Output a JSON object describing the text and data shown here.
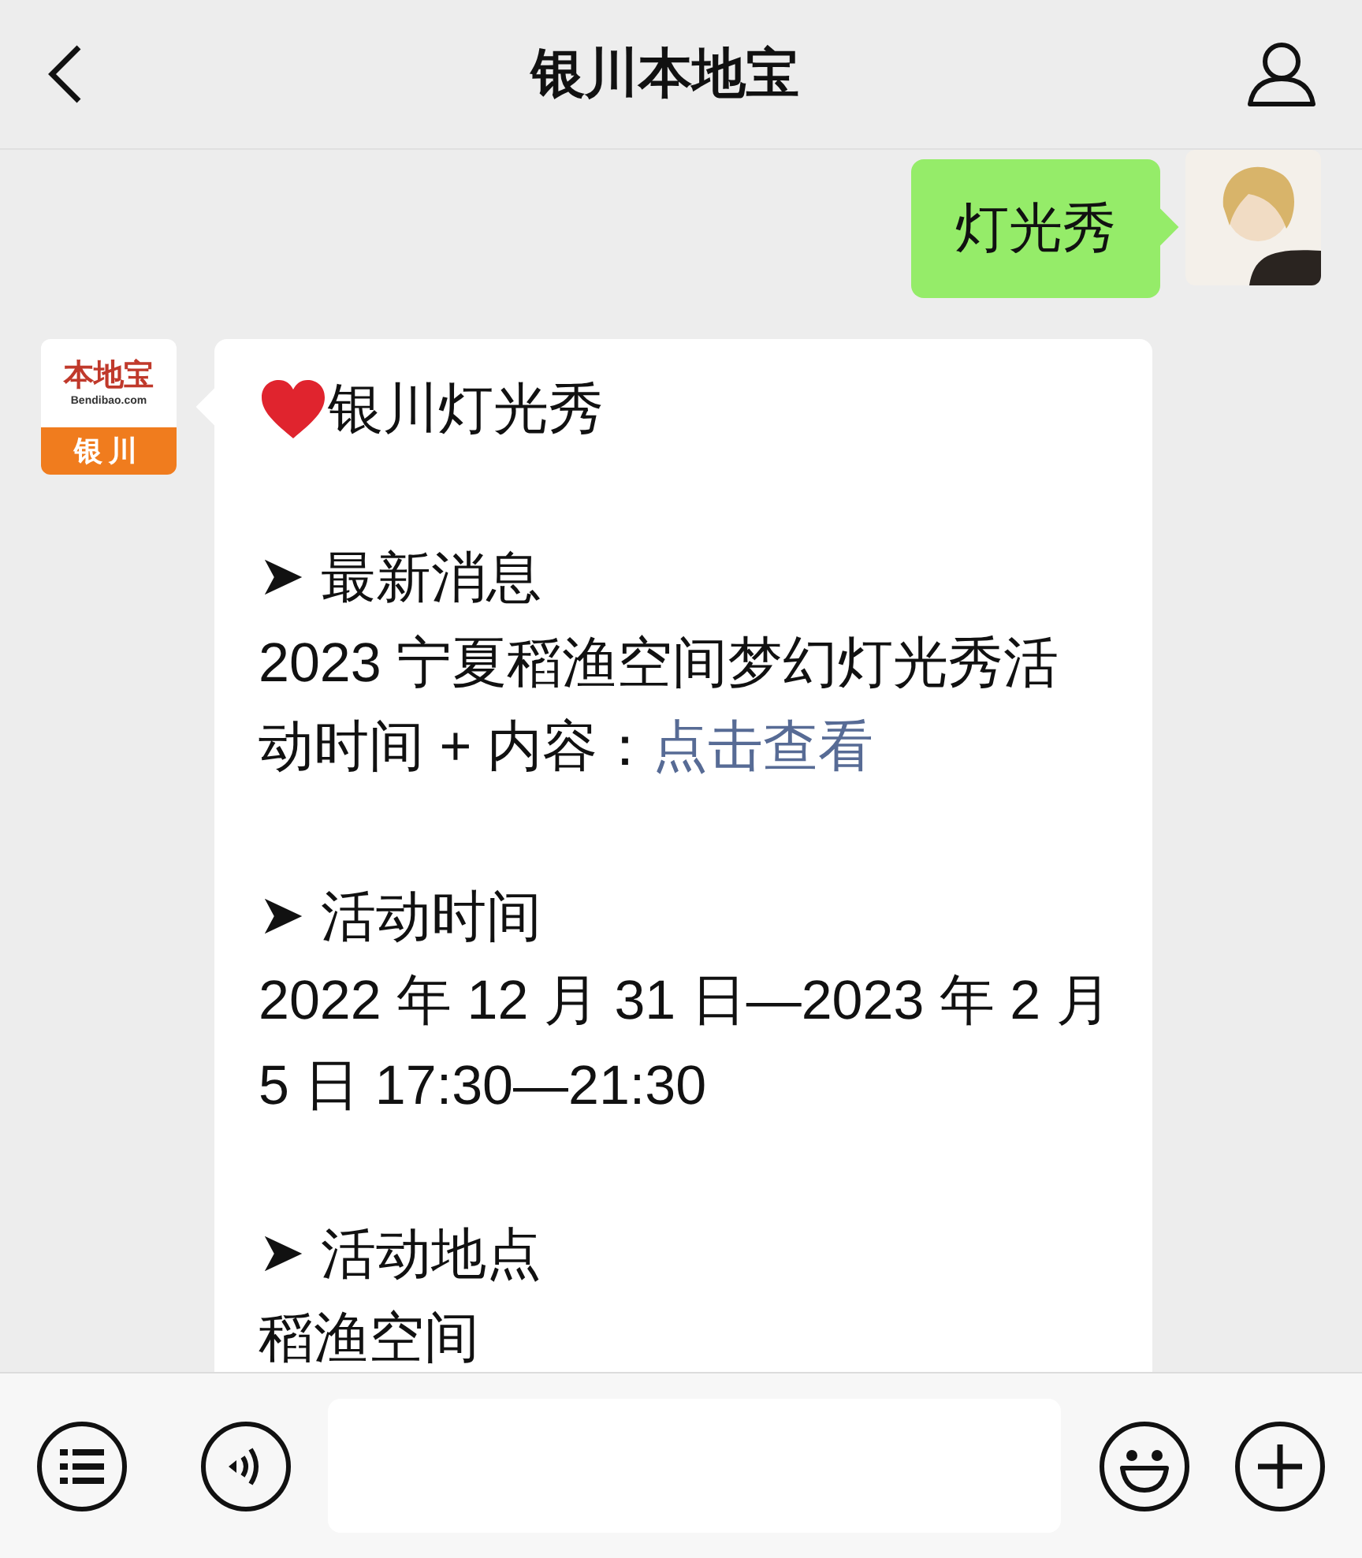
{
  "header": {
    "title": "银川本地宝"
  },
  "messages": [
    {
      "kind": "user_text",
      "text": "灯光秀"
    },
    {
      "kind": "account_article",
      "logo": {
        "brand": "本地宝",
        "site": "Bendibao.com",
        "city": "银川"
      },
      "title": "银川灯光秀",
      "sections": [
        {
          "bullet": "➤",
          "heading": "最新消息",
          "body": "2023 宁夏稻渔空间梦幻灯光秀活动时间 + 内容：",
          "link": "点击查看"
        },
        {
          "bullet": "➤",
          "heading": "活动时间",
          "body": "2022 年 12 月 31 日—2023 年 2 月 5 日 17:30—21:30"
        },
        {
          "bullet": "➤",
          "heading": "活动地点",
          "body": "稻渔空间"
        }
      ]
    }
  ]
}
